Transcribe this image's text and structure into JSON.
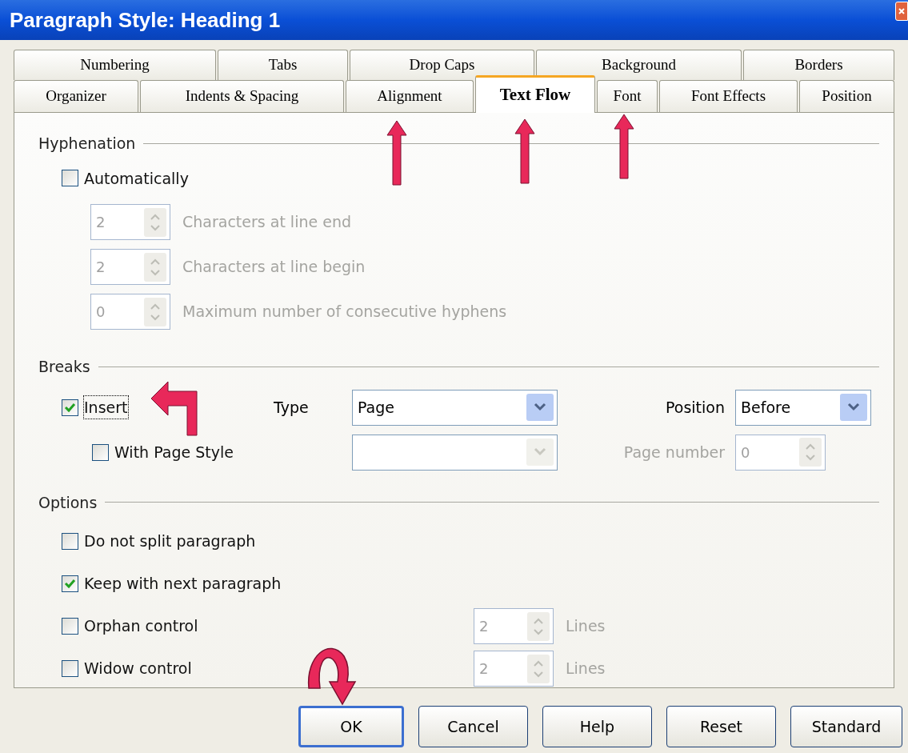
{
  "window": {
    "title": "Paragraph Style: Heading 1"
  },
  "tab_rows": [
    [
      {
        "label": "Numbering",
        "selected": false
      },
      {
        "label": "Tabs",
        "selected": false
      },
      {
        "label": "Drop Caps",
        "selected": false
      },
      {
        "label": "Background",
        "selected": false
      },
      {
        "label": "Borders",
        "selected": false
      }
    ],
    [
      {
        "label": "Organizer",
        "selected": false
      },
      {
        "label": "Indents & Spacing",
        "selected": false
      },
      {
        "label": "Alignment",
        "selected": false
      },
      {
        "label": "Text Flow",
        "selected": true
      },
      {
        "label": "Font",
        "selected": false
      },
      {
        "label": "Font Effects",
        "selected": false
      },
      {
        "label": "Position",
        "selected": false
      }
    ]
  ],
  "hyphenation": {
    "title": "Hyphenation",
    "automatically": {
      "label": "Automatically",
      "checked": false
    },
    "spins": [
      {
        "value": "2",
        "label": "Characters at line end",
        "disabled": true
      },
      {
        "value": "2",
        "label": "Characters at line begin",
        "disabled": true
      },
      {
        "value": "0",
        "label": "Maximum number of consecutive hyphens",
        "disabled": true
      }
    ]
  },
  "breaks": {
    "title": "Breaks",
    "insert": {
      "label": "Insert",
      "checked": true
    },
    "type_label": "Type",
    "type_value": "Page",
    "position_label": "Position",
    "position_value": "Before",
    "with_page_style": {
      "label": "With Page Style",
      "checked": false
    },
    "page_style_disabled": true,
    "page_number_label": "Page number",
    "page_number_value": "0",
    "page_number_disabled": true
  },
  "options": {
    "title": "Options",
    "items": [
      {
        "label": "Do not split paragraph",
        "checked": false
      },
      {
        "label": "Keep with next paragraph",
        "checked": true
      },
      {
        "label": "Orphan control",
        "checked": false,
        "lines_value": "2",
        "lines_label": "Lines",
        "lines_disabled": true
      },
      {
        "label": "Widow control",
        "checked": false,
        "lines_value": "2",
        "lines_label": "Lines",
        "lines_disabled": true
      }
    ]
  },
  "buttons": [
    {
      "label": "OK",
      "default": true
    },
    {
      "label": "Cancel",
      "default": false
    },
    {
      "label": "Help",
      "default": false
    },
    {
      "label": "Reset",
      "default": false
    },
    {
      "label": "Standard",
      "default": false
    }
  ]
}
